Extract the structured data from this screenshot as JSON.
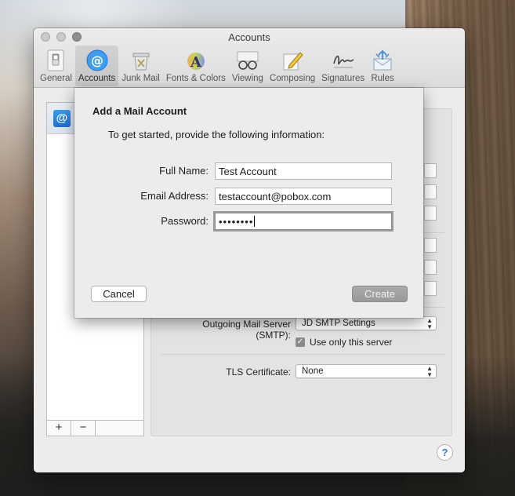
{
  "window": {
    "title": "Accounts"
  },
  "toolbar": {
    "items": [
      {
        "label": "General",
        "icon": "switch-icon"
      },
      {
        "label": "Accounts",
        "icon": "at-icon"
      },
      {
        "label": "Junk Mail",
        "icon": "trash-icon"
      },
      {
        "label": "Fonts & Colors",
        "icon": "font-icon"
      },
      {
        "label": "Viewing",
        "icon": "glasses-icon"
      },
      {
        "label": "Composing",
        "icon": "pencil-icon"
      },
      {
        "label": "Signatures",
        "icon": "signature-icon"
      },
      {
        "label": "Rules",
        "icon": "envelope-rules-icon"
      }
    ],
    "active": "Accounts"
  },
  "account_list": {
    "add_label": "+",
    "remove_label": "−"
  },
  "details": {
    "smtp_label": "Outgoing Mail Server (SMTP):",
    "smtp_value": "JD SMTP Settings",
    "use_only_label": "Use only this server",
    "use_only_checked": true,
    "tls_label": "TLS Certificate:",
    "tls_value": "None"
  },
  "sheet": {
    "title": "Add a Mail Account",
    "subtitle": "To get started, provide the following information:",
    "full_name_label": "Full Name:",
    "full_name_value": "Test Account",
    "email_label": "Email Address:",
    "email_value": "testaccount@pobox.com",
    "password_label": "Password:",
    "password_value": "••••••••",
    "cancel_label": "Cancel",
    "create_label": "Create"
  },
  "help_label": "?",
  "colors": {
    "accent_blue": "#1a6fd1",
    "create_button": "#9f9f9f"
  }
}
